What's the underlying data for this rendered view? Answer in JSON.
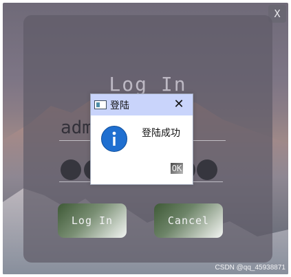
{
  "app": {
    "close_label": "X",
    "login_title": "Log In",
    "username_value": "adm",
    "password_dot_count": 4,
    "login_button_label": "Log In",
    "cancel_button_label": "Cancel"
  },
  "dialog": {
    "title": "登陆",
    "close_glyph": "✕",
    "message": "登陆成功",
    "ok_label": "OK",
    "info_icon": "info-icon"
  },
  "watermark": "CSDN @qq_45938871",
  "colors": {
    "dialog_titlebar": "#c9d4fb",
    "info_icon": "#1f6fd0",
    "button_dark": "#3e5936",
    "panel": "#5f5c68"
  }
}
